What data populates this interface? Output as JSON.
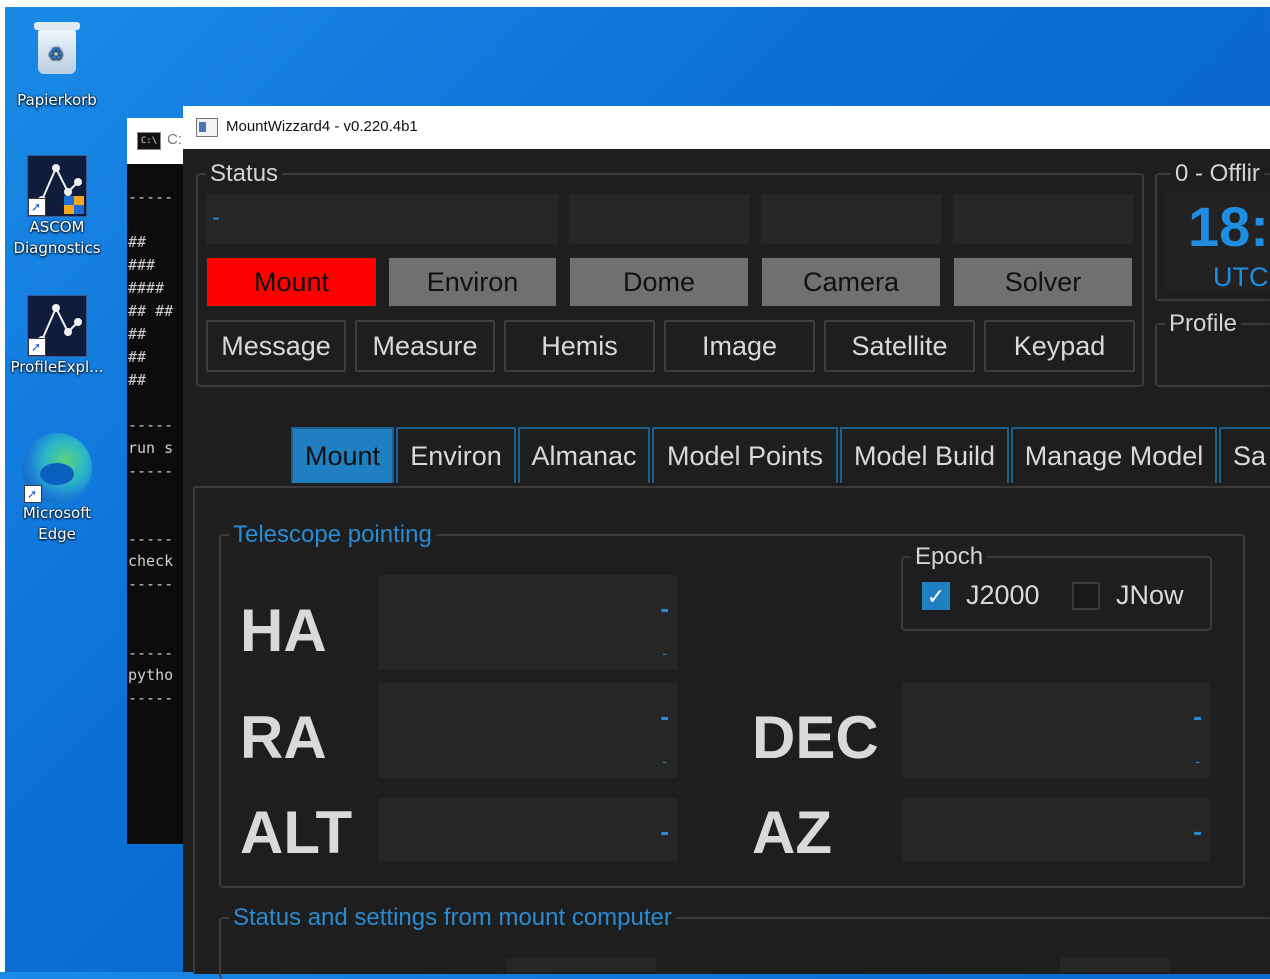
{
  "desktop": {
    "icons": [
      {
        "label_lines": [
          "Papierkorb"
        ]
      },
      {
        "label_lines": [
          "ASCOM",
          "Diagnostics"
        ]
      },
      {
        "label_lines": [
          "ProfileExpl..."
        ]
      },
      {
        "label_lines": [
          "Microsoft",
          "Edge"
        ]
      }
    ]
  },
  "console": {
    "title": "C:",
    "lines": [
      "-----",
      "##",
      "###",
      "####",
      "## ##",
      "##",
      "##",
      "##",
      "-----",
      "run s",
      "-----",
      "-----",
      "check",
      "-----",
      "-----",
      "pytho",
      "-----"
    ]
  },
  "window": {
    "title": "MountWizzard4 - v0.220.4b1"
  },
  "status": {
    "title": "Status",
    "field_text": "-",
    "buttons": [
      {
        "label": "Mount",
        "color": "#ff0000"
      },
      {
        "label": "Environ",
        "color": "#707070"
      },
      {
        "label": "Dome",
        "color": "#707070"
      },
      {
        "label": "Camera",
        "color": "#707070"
      },
      {
        "label": "Solver",
        "color": "#707070"
      }
    ],
    "nav_buttons": [
      "Message",
      "Measure",
      "Hemis",
      "Image",
      "Satellite",
      "Keypad"
    ]
  },
  "right_panel": {
    "offline_title": "0 - Offlir",
    "time": "18:",
    "timezone": "UTC",
    "profile_title": "Profile"
  },
  "tabs": [
    {
      "label": "Mount",
      "active": true
    },
    {
      "label": "Environ",
      "active": false
    },
    {
      "label": "Almanac",
      "active": false
    },
    {
      "label": "Model Points",
      "active": false
    },
    {
      "label": "Model Build",
      "active": false
    },
    {
      "label": "Manage Model",
      "active": false
    },
    {
      "label": "Sa",
      "active": false
    }
  ],
  "telescope": {
    "title": "Telescope pointing",
    "epoch": {
      "title": "Epoch",
      "j2000_label": "J2000",
      "j2000_checked": true,
      "jnow_label": "JNow",
      "jnow_checked": false
    },
    "labels": {
      "ha": "HA",
      "ra": "RA",
      "dec": "DEC",
      "alt": "ALT",
      "az": "AZ"
    },
    "value_dash": "-",
    "sub_dash": "-"
  },
  "mount_status": {
    "title": "Status and settings from mount computer"
  },
  "colors": {
    "accent": "#1f7fc0",
    "status_red": "#ff0000",
    "status_gray": "#707070",
    "panel_bg": "#1e1e1e"
  }
}
